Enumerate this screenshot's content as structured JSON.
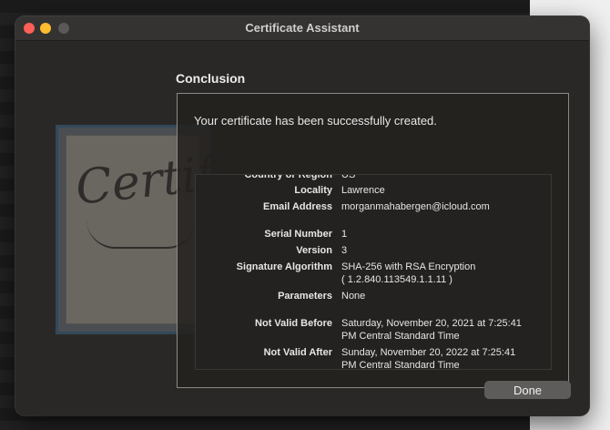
{
  "window": {
    "title": "Certificate Assistant"
  },
  "heading": "Conclusion",
  "message": "Your certificate has been successfully created.",
  "details": [
    {
      "label": "Country or Region",
      "value": "US"
    },
    {
      "label": "Locality",
      "value": "Lawrence"
    },
    {
      "label": "Email Address",
      "value": "morganmahabergen@icloud.com"
    },
    {
      "label": "Serial Number",
      "value": "1"
    },
    {
      "label": "Version",
      "value": "3"
    },
    {
      "label": "Signature Algorithm",
      "value": "SHA-256 with RSA Encryption",
      "value2": "( 1.2.840.113549.1.1.11 )"
    },
    {
      "label": "Parameters",
      "value": "None"
    },
    {
      "label": "Not Valid Before",
      "value": "Saturday, November 20, 2021 at 7:25:41",
      "value2": "PM Central Standard Time"
    },
    {
      "label": "Not Valid After",
      "value": "Sunday, November 20, 2022 at 7:25:41",
      "value2": "PM Central Standard Time"
    }
  ],
  "certificate_image_text": "Certif",
  "buttons": {
    "done": "Done"
  },
  "colors": {
    "close": "#fe5f57",
    "minimize": "#febc2e",
    "zoom": "#5b5957"
  }
}
